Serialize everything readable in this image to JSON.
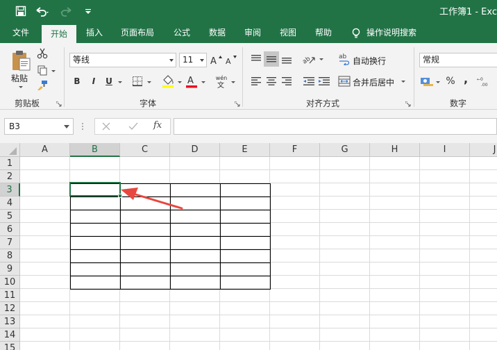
{
  "window": {
    "title": "工作簿1 - Exc"
  },
  "tabs": [
    {
      "id": "file",
      "label": "文件",
      "active": false
    },
    {
      "id": "home",
      "label": "开始",
      "active": true
    },
    {
      "id": "insert",
      "label": "插入",
      "active": false
    },
    {
      "id": "page_layout",
      "label": "页面布局",
      "active": false
    },
    {
      "id": "formulas",
      "label": "公式",
      "active": false
    },
    {
      "id": "data",
      "label": "数据",
      "active": false
    },
    {
      "id": "review",
      "label": "审阅",
      "active": false
    },
    {
      "id": "view",
      "label": "视图",
      "active": false
    },
    {
      "id": "help",
      "label": "帮助",
      "active": false
    }
  ],
  "tell_me": "操作说明搜索",
  "ribbon": {
    "clipboard": {
      "paste_label": "粘贴",
      "group_label": "剪贴板"
    },
    "font": {
      "font_name": "等线",
      "font_size": "11",
      "group_label": "字体",
      "bold": "B",
      "italic": "I",
      "underline": "U",
      "phonetic": "wén"
    },
    "alignment": {
      "wrap_text": "自动换行",
      "merge_center": "合并后居中",
      "group_label": "对齐方式"
    },
    "number": {
      "format": "常规",
      "group_label": "数字",
      "percent": "%",
      "comma": ","
    }
  },
  "formula_bar": {
    "name_box": "B3",
    "fx": "fx",
    "value": ""
  },
  "sheet": {
    "columns": [
      "A",
      "B",
      "C",
      "D",
      "E",
      "F",
      "G",
      "H",
      "I",
      "J"
    ],
    "rows": [
      "1",
      "2",
      "3",
      "4",
      "5",
      "6",
      "7",
      "8",
      "9",
      "10",
      "11",
      "12",
      "13",
      "14",
      "15"
    ],
    "selected_cell": "B3",
    "selected_column": "B",
    "selected_row": "3",
    "bordered_range": "B3:E10"
  },
  "colors": {
    "accent": "#217346",
    "ribbon_bg": "#f3f3f3",
    "header_bg": "#e6e6e6",
    "arrow": "#e8473f",
    "font_color_bar": "#e81123",
    "fill_color_bar": "#ffff00"
  },
  "icons": {
    "save": "save-icon",
    "undo": "undo-icon",
    "redo": "redo-icon",
    "customize": "customize-qat-icon",
    "bulb": "lightbulb-icon",
    "cut": "cut-icon",
    "copy": "copy-icon",
    "format_painter": "format-painter-icon",
    "borders": "borders-icon",
    "fill_color": "fill-color-icon",
    "font_color": "font-color-icon",
    "annotation_arrow": "annotation-arrow-icon"
  }
}
